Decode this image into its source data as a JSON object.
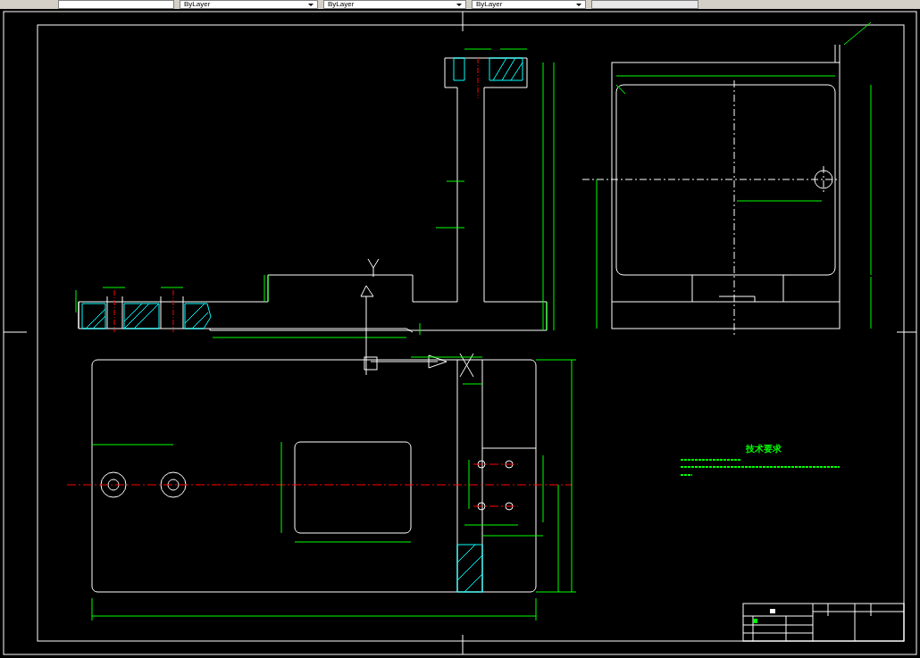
{
  "toolbar": {
    "dropdowns": [
      {
        "value": "ByLayer"
      },
      {
        "value": "ByLayer"
      },
      {
        "value": "ByLayer"
      }
    ]
  },
  "drawing": {
    "notes_title": "技术要求"
  }
}
